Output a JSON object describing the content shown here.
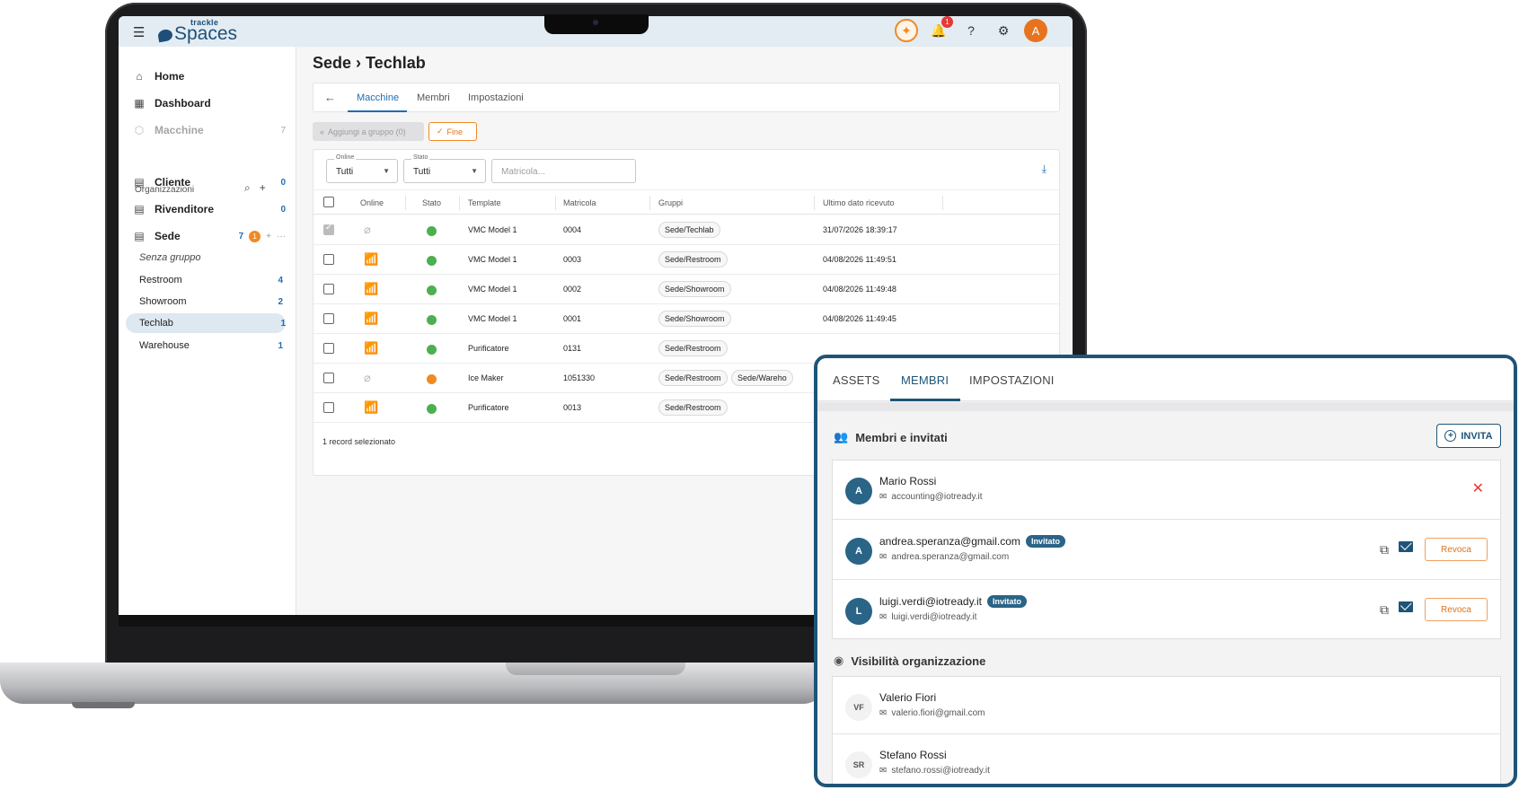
{
  "app": {
    "logo_small": "trackle",
    "logo_big": "Spaces",
    "avatar_letter": "A",
    "notification_count": "1"
  },
  "sidebar": {
    "home": "Home",
    "dashboard": "Dashboard",
    "machines": "Macchine",
    "machines_count": "7",
    "section_title": "Organizzazioni",
    "orgs": [
      {
        "label": "Cliente",
        "count": "0"
      },
      {
        "label": "Rivenditore",
        "count": "0"
      },
      {
        "label": "Sede",
        "count": "7",
        "badge": "1"
      }
    ],
    "groups": [
      {
        "label": "Senza gruppo",
        "count": ""
      },
      {
        "label": "Restroom",
        "count": "4"
      },
      {
        "label": "Showroom",
        "count": "2"
      },
      {
        "label": "Techlab",
        "count": "1"
      },
      {
        "label": "Warehouse",
        "count": "1"
      }
    ]
  },
  "main": {
    "breadcrumb": "Sede › Techlab",
    "tabs": [
      "Macchine",
      "Membri",
      "Impostazioni"
    ],
    "add_group_label": "Aggiungi a gruppo (0)",
    "done_label": "Fine",
    "filters": {
      "online_label": "Online",
      "online_value": "Tutti",
      "status_label": "Stato",
      "status_value": "Tutti",
      "serial_placeholder": "Matricola..."
    },
    "columns": [
      "Online",
      "Stato",
      "Template",
      "Matricola",
      "Gruppi",
      "Ultimo dato ricevuto"
    ],
    "rows": [
      {
        "checked": true,
        "online": false,
        "status_color": "#4caf50",
        "template": "VMC Model 1",
        "serial": "0004",
        "groups": [
          "Sede/Techlab"
        ],
        "last": "31/07/2026 18:39:17"
      },
      {
        "checked": false,
        "online": true,
        "status_color": "#4caf50",
        "template": "VMC Model 1",
        "serial": "0003",
        "groups": [
          "Sede/Restroom"
        ],
        "last": "04/08/2026 11:49:51"
      },
      {
        "checked": false,
        "online": true,
        "status_color": "#4caf50",
        "template": "VMC Model 1",
        "serial": "0002",
        "groups": [
          "Sede/Showroom"
        ],
        "last": "04/08/2026 11:49:48"
      },
      {
        "checked": false,
        "online": true,
        "status_color": "#4caf50",
        "template": "VMC Model 1",
        "serial": "0001",
        "groups": [
          "Sede/Showroom"
        ],
        "last": "04/08/2026 11:49:45"
      },
      {
        "checked": false,
        "online": true,
        "status_color": "#4caf50",
        "template": "Purificatore",
        "serial": "0131",
        "groups": [
          "Sede/Restroom"
        ],
        "last": ""
      },
      {
        "checked": false,
        "online": false,
        "status_color": "#f08a24",
        "template": "Ice Maker",
        "serial": "1051330",
        "groups": [
          "Sede/Restroom",
          "Sede/Wareho"
        ],
        "last": ""
      },
      {
        "checked": false,
        "online": true,
        "status_color": "#4caf50",
        "template": "Purificatore",
        "serial": "0013",
        "groups": [
          "Sede/Restroom"
        ],
        "last": ""
      }
    ],
    "footer": "1 record selezionato"
  },
  "panel": {
    "tabs": [
      "ASSETS",
      "MEMBRI",
      "IMPOSTAZIONI"
    ],
    "members_title": "Membri e invitati",
    "invite_label": "INVITA",
    "members": [
      {
        "initial": "A",
        "name": "Mario Rossi",
        "email": "accounting@iotready.it",
        "invited": false
      },
      {
        "initial": "A",
        "name": "andrea.speranza@gmail.com",
        "email": "andrea.speranza@gmail.com",
        "invited": true
      },
      {
        "initial": "L",
        "name": "luigi.verdi@iotready.it",
        "email": "luigi.verdi@iotready.it",
        "invited": true
      }
    ],
    "invited_tag": "Invitato",
    "revoke_label": "Revoca",
    "visibility_title": "Visibilità organizzazione",
    "visibility": [
      {
        "initials": "VF",
        "name": "Valerio Fiori",
        "email": "valerio.fiori@gmail.com"
      },
      {
        "initials": "SR",
        "name": "Stefano Rossi",
        "email": "stefano.rossi@iotready.it"
      }
    ]
  },
  "colors": {
    "brand": "#1f4e79",
    "accent": "#1f6fb2",
    "panel_border": "#1f5478",
    "warning": "#f08a24",
    "online_status": "#4caf50"
  }
}
